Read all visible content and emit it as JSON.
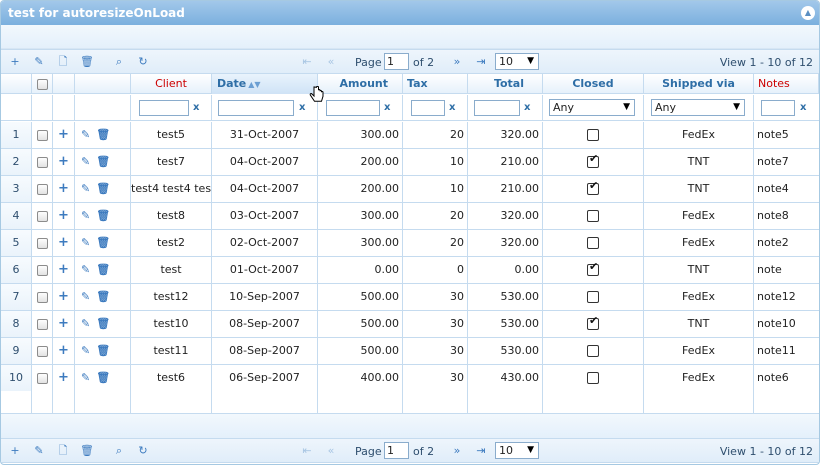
{
  "window": {
    "title": "test for autoresizeOnLoad",
    "collapse_icon": "chevron-up-icon"
  },
  "pager": {
    "page_label": "Page",
    "page_value": "1",
    "of_label": "of 2",
    "rows_per_page": "10",
    "view_text": "View 1 - 10 of 12"
  },
  "columns": [
    {
      "key": "client",
      "label": "Client",
      "required": true
    },
    {
      "key": "date",
      "label": "Date",
      "sorted": "asc"
    },
    {
      "key": "amount",
      "label": "Amount"
    },
    {
      "key": "tax",
      "label": "Tax"
    },
    {
      "key": "total",
      "label": "Total"
    },
    {
      "key": "closed",
      "label": "Closed"
    },
    {
      "key": "ship",
      "label": "Shipped via"
    },
    {
      "key": "notes",
      "label": "Notes",
      "required": true
    }
  ],
  "filters": {
    "closed": "Any",
    "ship": "Any",
    "clear": "x"
  },
  "rows": [
    {
      "rn": "1",
      "client": "test5",
      "date": "31-Oct-2007",
      "amount": "300.00",
      "tax": "20",
      "total": "320.00",
      "closed": false,
      "ship": "FedEx",
      "notes": "note5"
    },
    {
      "rn": "2",
      "client": "test7",
      "date": "04-Oct-2007",
      "amount": "200.00",
      "tax": "10",
      "total": "210.00",
      "closed": true,
      "ship": "TNT",
      "notes": "note7"
    },
    {
      "rn": "3",
      "client": "test4 test4 tes",
      "date": "04-Oct-2007",
      "amount": "200.00",
      "tax": "10",
      "total": "210.00",
      "closed": true,
      "ship": "TNT",
      "notes": "note4"
    },
    {
      "rn": "4",
      "client": "test8",
      "date": "03-Oct-2007",
      "amount": "300.00",
      "tax": "20",
      "total": "320.00",
      "closed": false,
      "ship": "FedEx",
      "notes": "note8"
    },
    {
      "rn": "5",
      "client": "test2",
      "date": "02-Oct-2007",
      "amount": "300.00",
      "tax": "20",
      "total": "320.00",
      "closed": false,
      "ship": "FedEx",
      "notes": "note2"
    },
    {
      "rn": "6",
      "client": "test",
      "date": "01-Oct-2007",
      "amount": "0.00",
      "tax": "0",
      "total": "0.00",
      "closed": true,
      "ship": "TNT",
      "notes": "note"
    },
    {
      "rn": "7",
      "client": "test12",
      "date": "10-Sep-2007",
      "amount": "500.00",
      "tax": "30",
      "total": "530.00",
      "closed": false,
      "ship": "FedEx",
      "notes": "note12"
    },
    {
      "rn": "8",
      "client": "test10",
      "date": "08-Sep-2007",
      "amount": "500.00",
      "tax": "30",
      "total": "530.00",
      "closed": true,
      "ship": "TNT",
      "notes": "note10"
    },
    {
      "rn": "9",
      "client": "test11",
      "date": "08-Sep-2007",
      "amount": "500.00",
      "tax": "30",
      "total": "530.00",
      "closed": false,
      "ship": "FedEx",
      "notes": "note11"
    },
    {
      "rn": "10",
      "client": "test6",
      "date": "06-Sep-2007",
      "amount": "400.00",
      "tax": "30",
      "total": "430.00",
      "closed": false,
      "ship": "FedEx",
      "notes": "note6"
    }
  ],
  "icons": {
    "add": "plus-icon",
    "edit": "pencil-icon",
    "view": "document-icon",
    "delete": "trash-icon",
    "search": "search-icon",
    "refresh": "refresh-icon",
    "first": "first-page-icon",
    "prev": "prev-page-icon",
    "next": "next-page-icon",
    "last": "last-page-icon"
  },
  "colors": {
    "header_text": "#2e6ea6",
    "required_text": "#cc0000",
    "titlebar": "#7bb0de"
  }
}
